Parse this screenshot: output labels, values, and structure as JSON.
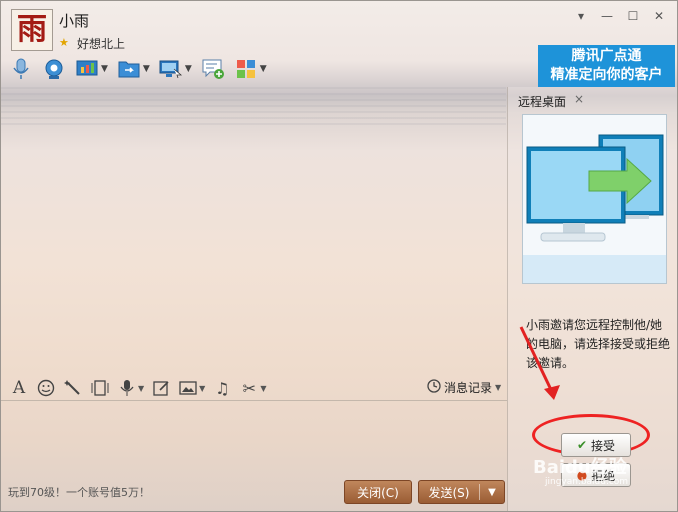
{
  "contact": {
    "avatar_char": "雨",
    "name": "小雨",
    "signature": "好想北上"
  },
  "window_controls": [
    "dropdown-icon",
    "minimize-icon",
    "maximize-icon",
    "close-icon"
  ],
  "ad": {
    "line1": "腾讯广点通",
    "line2": "精准定向你的客户"
  },
  "toolbar": {
    "icons": [
      "voice-call-icon",
      "video-call-icon",
      "app-share-icon",
      "file-transfer-icon",
      "remote-desktop-icon",
      "create-group-icon",
      "apps-icon"
    ]
  },
  "remote_panel": {
    "title": "远程桌面",
    "close": "×",
    "message": "小雨邀请您远程控制他/她的电脑，请选择接受或拒绝该邀请。",
    "accept_label": "接受",
    "reject_label": "拒绝"
  },
  "input_toolbar": {
    "icons": [
      "font-icon",
      "emoji-icon",
      "magic-icon",
      "gif-icon",
      "mic-icon",
      "edit-image-icon",
      "picture-icon",
      "music-icon",
      "scissors-icon"
    ]
  },
  "history": {
    "label": "消息记录"
  },
  "footer": {
    "promo": "玩到70级！一个账号值5万！",
    "close_label": "关闭(C)",
    "send_label": "发送(S)"
  },
  "watermark": {
    "text": "Baidu经验",
    "sub": "jingyan.baidu.com"
  },
  "colors": {
    "accent": "#1e93d9",
    "button": "#a9673d",
    "annotation": "#e22222"
  }
}
